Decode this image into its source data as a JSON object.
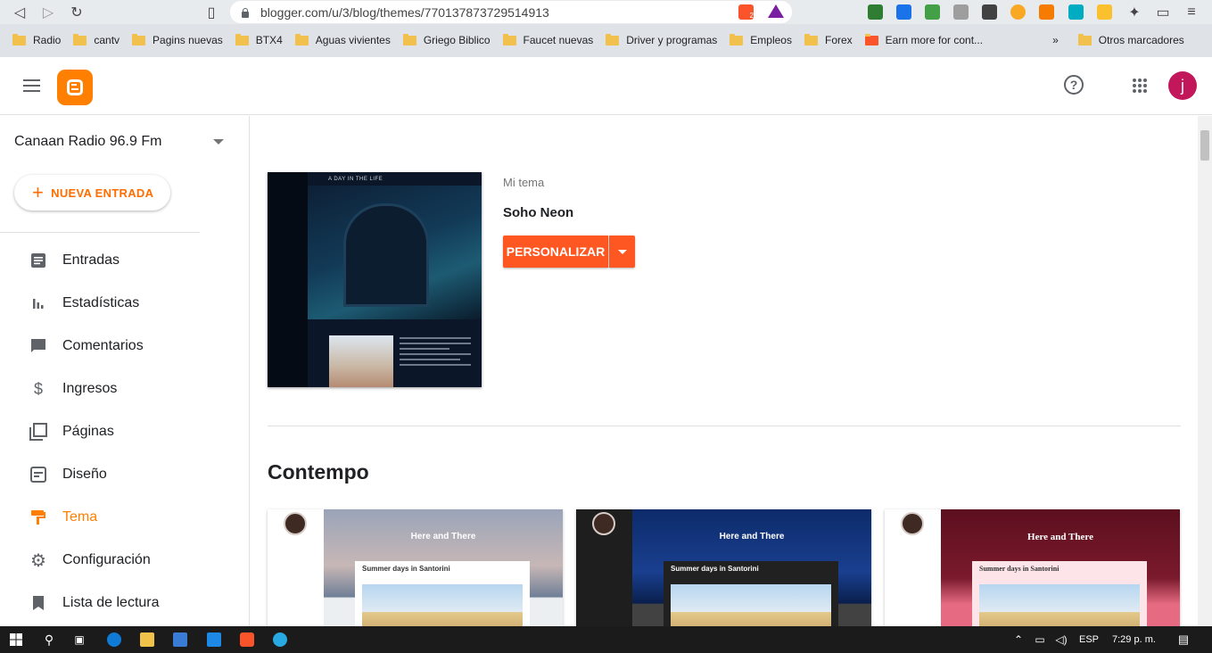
{
  "browser": {
    "url": "blogger.com/u/3/blog/themes/770137873729514913",
    "shield_badge": "2",
    "bookmarks": [
      {
        "label": "Radio"
      },
      {
        "label": "cantv"
      },
      {
        "label": "Pagins nuevas"
      },
      {
        "label": "BTX4"
      },
      {
        "label": "Aguas vivientes"
      },
      {
        "label": "Griego Biblico"
      },
      {
        "label": "Faucet nuevas"
      },
      {
        "label": "Driver y programas"
      },
      {
        "label": "Empleos"
      },
      {
        "label": "Forex"
      },
      {
        "label": "Earn more for cont..."
      }
    ],
    "more_bookmarks": "»",
    "other_bookmarks": "Otros marcadores"
  },
  "header": {
    "avatar_letter": "j",
    "help_glyph": "?"
  },
  "sidebar": {
    "blog_name": "Canaan Radio 96.9 Fm",
    "new_post_label": "NUEVA ENTRADA",
    "items": [
      {
        "label": "Entradas",
        "icon": "posts-icon"
      },
      {
        "label": "Estadísticas",
        "icon": "stats-icon"
      },
      {
        "label": "Comentarios",
        "icon": "comments-icon"
      },
      {
        "label": "Ingresos",
        "icon": "earnings-icon"
      },
      {
        "label": "Páginas",
        "icon": "pages-icon"
      },
      {
        "label": "Diseño",
        "icon": "layout-icon"
      },
      {
        "label": "Tema",
        "icon": "theme-icon",
        "active": true
      },
      {
        "label": "Configuración",
        "icon": "settings-icon"
      },
      {
        "label": "Lista de lectura",
        "icon": "reading-list-icon"
      }
    ]
  },
  "main": {
    "my_theme_label": "Mi tema",
    "theme_name": "Soho Neon",
    "customize_label": "PERSONALIZAR",
    "thumbnail_title": "A DAY IN THE LIFE",
    "section_title": "Contempo",
    "cards": [
      {
        "title": "Here and There",
        "post_title": "Summer days in Santorini"
      },
      {
        "title": "Here and There",
        "post_title": "Summer days in Santorini"
      },
      {
        "title": "Here and There",
        "post_title": "Summer days in Santorini"
      }
    ]
  },
  "taskbar": {
    "language": "ESP",
    "time": "7:29 p. m."
  },
  "colors": {
    "accent": "#ff8000",
    "button": "#ff5722",
    "avatar": "#c2185b"
  }
}
